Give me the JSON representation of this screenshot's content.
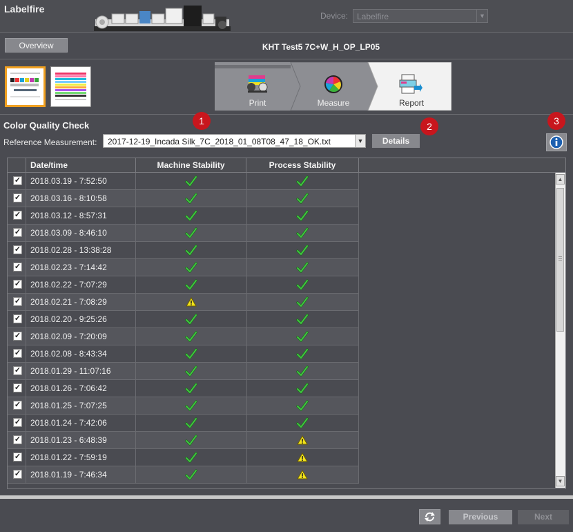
{
  "header": {
    "app_title": "Labelfire",
    "device_label": "Device:",
    "device_value": "Labelfire"
  },
  "toolbar": {
    "overview_label": "Overview",
    "job_title": "KHT Test5 7C+W_H_OP_LP05"
  },
  "workflow": {
    "steps": [
      "Print",
      "Measure",
      "Report"
    ],
    "active_step": "Report"
  },
  "quality": {
    "title": "Color Quality Check",
    "reference_label": "Reference Measurement:",
    "reference_value": "2017-12-19_Incada Silk_7C_2018_01_08T08_47_18_OK.txt",
    "details_label": "Details"
  },
  "badges": [
    "1",
    "2",
    "3"
  ],
  "table": {
    "columns": [
      "Date/time",
      "Machine Stability",
      "Process Stability"
    ],
    "rows": [
      {
        "checked": true,
        "datetime": "2018.03.19 - 7:52:50",
        "machine": "ok",
        "process": "ok"
      },
      {
        "checked": true,
        "datetime": "2018.03.16 - 8:10:58",
        "machine": "ok",
        "process": "ok"
      },
      {
        "checked": true,
        "datetime": "2018.03.12 - 8:57:31",
        "machine": "ok",
        "process": "ok"
      },
      {
        "checked": true,
        "datetime": "2018.03.09 - 8:46:10",
        "machine": "ok",
        "process": "ok"
      },
      {
        "checked": true,
        "datetime": "2018.02.28 - 13:38:28",
        "machine": "ok",
        "process": "ok"
      },
      {
        "checked": true,
        "datetime": "2018.02.23 - 7:14:42",
        "machine": "ok",
        "process": "ok"
      },
      {
        "checked": true,
        "datetime": "2018.02.22 - 7:07:29",
        "machine": "ok",
        "process": "ok"
      },
      {
        "checked": true,
        "datetime": "2018.02.21 - 7:08:29",
        "machine": "warning",
        "process": "ok"
      },
      {
        "checked": true,
        "datetime": "2018.02.20 - 9:25:26",
        "machine": "ok",
        "process": "ok"
      },
      {
        "checked": true,
        "datetime": "2018.02.09 - 7:20:09",
        "machine": "ok",
        "process": "ok"
      },
      {
        "checked": true,
        "datetime": "2018.02.08 - 8:43:34",
        "machine": "ok",
        "process": "ok"
      },
      {
        "checked": true,
        "datetime": "2018.01.29 - 11:07:16",
        "machine": "ok",
        "process": "ok"
      },
      {
        "checked": true,
        "datetime": "2018.01.26 - 7:06:42",
        "machine": "ok",
        "process": "ok"
      },
      {
        "checked": true,
        "datetime": "2018.01.25 - 7:07:25",
        "machine": "ok",
        "process": "ok"
      },
      {
        "checked": true,
        "datetime": "2018.01.24 - 7:42:06",
        "machine": "ok",
        "process": "ok"
      },
      {
        "checked": true,
        "datetime": "2018.01.23 - 6:48:39",
        "machine": "ok",
        "process": "warning"
      },
      {
        "checked": true,
        "datetime": "2018.01.22 - 7:59:19",
        "machine": "ok",
        "process": "warning"
      },
      {
        "checked": true,
        "datetime": "2018.01.19 - 7:46:34",
        "machine": "ok",
        "process": "warning"
      }
    ]
  },
  "footer": {
    "previous_label": "Previous",
    "next_label": "Next"
  },
  "colors": {
    "ok_green": "#3fc23f",
    "warning_yellow": "#f2e31c",
    "badge_red": "#c8161d",
    "thumb_active_border": "#f0a020"
  }
}
